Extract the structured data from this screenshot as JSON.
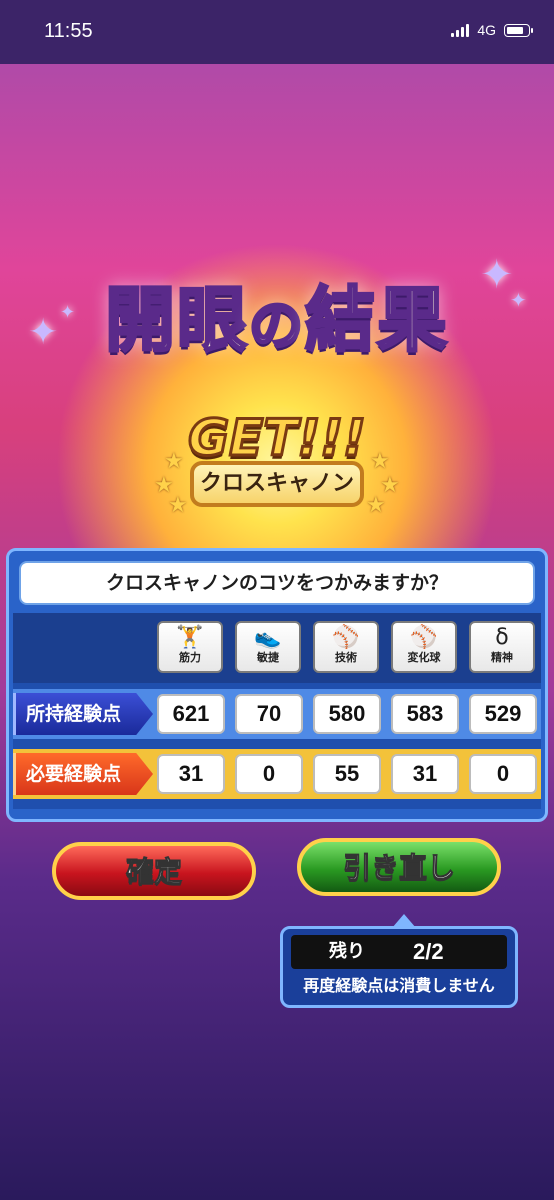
{
  "status_bar": {
    "time": "11:55",
    "network": "4G"
  },
  "title": {
    "part1": "開眼",
    "part2": "の",
    "part3": "結果"
  },
  "badge": {
    "get_text": "GET!!!",
    "skill_name": "クロスキャノン"
  },
  "panel": {
    "question": "クロスキャノンのコツをつかみますか？",
    "stats": [
      {
        "label": "筋力",
        "icon": "dumbbell-icon",
        "glyph": "🏋"
      },
      {
        "label": "敏捷",
        "icon": "sneaker-icon",
        "glyph": "👟"
      },
      {
        "label": "技術",
        "icon": "bat-icon",
        "glyph": "⚾"
      },
      {
        "label": "変化球",
        "icon": "baseball-icon",
        "glyph": "⚾"
      },
      {
        "label": "精神",
        "icon": "spirit-icon",
        "glyph": "δ"
      }
    ],
    "owned": {
      "label": "所持経験点",
      "values": [
        "621",
        "70",
        "580",
        "583",
        "529"
      ]
    },
    "required": {
      "label": "必要経験点",
      "values": [
        "31",
        "0",
        "55",
        "31",
        "0"
      ]
    }
  },
  "buttons": {
    "confirm": "確定",
    "redraw": "引き直し"
  },
  "remaining": {
    "label": "残り",
    "value": "2/2",
    "note": "再度経験点は消費しません"
  },
  "colors": {
    "owned_row": "#4f8ae6",
    "required_row": "#f3c23a",
    "confirm": "#c8141e",
    "redraw": "#2a9a22"
  }
}
